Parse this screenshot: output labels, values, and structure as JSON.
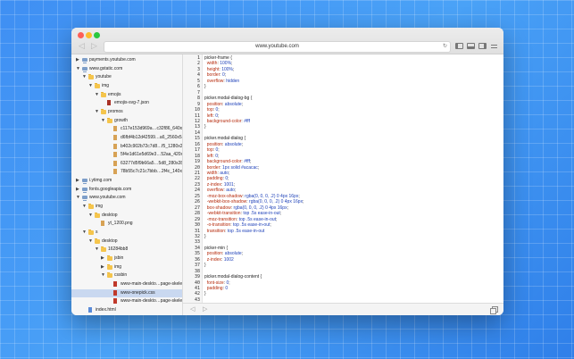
{
  "browser": {
    "url": "www.youtube.com",
    "back_glyph": "◁",
    "forward_glyph": "▷",
    "reload_glyph": "↻"
  },
  "tree": [
    {
      "label": "payments.youtube.com",
      "icon": "site",
      "depth": 0,
      "expanded": false
    },
    {
      "label": "www.gstatic.com",
      "icon": "site",
      "depth": 0,
      "expanded": true
    },
    {
      "label": "youtube",
      "icon": "folder",
      "depth": 1,
      "expanded": true
    },
    {
      "label": "img",
      "icon": "folder",
      "depth": 2,
      "expanded": true
    },
    {
      "label": "emojis",
      "icon": "folder",
      "depth": 3,
      "expanded": true
    },
    {
      "label": "emojis-svg-7.json",
      "icon": "json",
      "depth": 4
    },
    {
      "label": "promos",
      "icon": "folder",
      "depth": 3,
      "expanded": true
    },
    {
      "label": "growth",
      "icon": "folder",
      "depth": 4,
      "expanded": true
    },
    {
      "label": "c117e153d969a…c32f86_640x48.png",
      "icon": "img",
      "depth": 5
    },
    {
      "label": "d6fbf4b12d42599…a6_2560x520.jpeg",
      "icon": "img",
      "depth": 5
    },
    {
      "label": "b402c902b72c7d8…f5_1280x260.jpeg",
      "icon": "img",
      "depth": 5
    },
    {
      "label": "5f4e1d61e5d69e3…52aa_420x420.png",
      "icon": "img",
      "depth": 5
    },
    {
      "label": "63277d5f9b66a5…5d8_280x280.png",
      "icon": "img",
      "depth": 5
    },
    {
      "label": "78b55c7c21c7bbb…2f4c_140x140.png",
      "icon": "img",
      "depth": 5
    },
    {
      "label": "i.ytimg.com",
      "icon": "site",
      "depth": 0,
      "expanded": false
    },
    {
      "label": "fonts.googleapis.com",
      "icon": "site",
      "depth": 0,
      "expanded": false
    },
    {
      "label": "www.youtube.com",
      "icon": "site",
      "depth": 0,
      "expanded": true
    },
    {
      "label": "img",
      "icon": "folder",
      "depth": 1,
      "expanded": true
    },
    {
      "label": "desktop",
      "icon": "folder",
      "depth": 2,
      "expanded": true
    },
    {
      "label": "yt_1200.png",
      "icon": "img",
      "depth": 3
    },
    {
      "label": "s",
      "icon": "folder",
      "depth": 1,
      "expanded": true
    },
    {
      "label": "desktop",
      "icon": "folder",
      "depth": 2,
      "expanded": true
    },
    {
      "label": "16284bb8",
      "icon": "folder",
      "depth": 3,
      "expanded": true
    },
    {
      "label": "jsbin",
      "icon": "folder",
      "depth": 4,
      "expanded": false
    },
    {
      "label": "img",
      "icon": "folder",
      "depth": 4,
      "expanded": false
    },
    {
      "label": "cssbin",
      "icon": "folder",
      "depth": 4,
      "expanded": true
    },
    {
      "label": "www-main-deskto…page-skeleton.css",
      "icon": "css",
      "depth": 5
    },
    {
      "label": "www-onepick.css",
      "icon": "css",
      "depth": 5,
      "selected": true
    },
    {
      "label": "www-main-deskto…page-skeleton.css",
      "icon": "css",
      "depth": 5
    },
    {
      "label": "index.html",
      "icon": "html",
      "depth": 1
    }
  ],
  "code_lines": [
    [
      [
        "sel",
        "picker-frame "
      ],
      [
        "punc",
        "{"
      ]
    ],
    [
      [
        "prop",
        "  width"
      ],
      [
        "punc",
        ": "
      ],
      [
        "val",
        "100%"
      ],
      [
        "punc",
        ";"
      ]
    ],
    [
      [
        "prop",
        "  height"
      ],
      [
        "punc",
        ": "
      ],
      [
        "val",
        "100%"
      ],
      [
        "punc",
        ";"
      ]
    ],
    [
      [
        "prop",
        "  border"
      ],
      [
        "punc",
        ": "
      ],
      [
        "val",
        "0"
      ],
      [
        "punc",
        ";"
      ]
    ],
    [
      [
        "prop",
        "  overflow"
      ],
      [
        "punc",
        ": "
      ],
      [
        "val",
        "hidden"
      ]
    ],
    [
      [
        "punc",
        "}"
      ]
    ],
    [],
    [
      [
        "sel",
        "picker.modal-dialog-bg "
      ],
      [
        "punc",
        "{"
      ]
    ],
    [
      [
        "prop",
        "  position"
      ],
      [
        "punc",
        ": "
      ],
      [
        "val",
        "absolute"
      ],
      [
        "punc",
        ";"
      ]
    ],
    [
      [
        "prop",
        "  top"
      ],
      [
        "punc",
        ": "
      ],
      [
        "val",
        "0"
      ],
      [
        "punc",
        ";"
      ]
    ],
    [
      [
        "prop",
        "  left"
      ],
      [
        "punc",
        ": "
      ],
      [
        "val",
        "0"
      ],
      [
        "punc",
        ";"
      ]
    ],
    [
      [
        "prop",
        "  background-color"
      ],
      [
        "punc",
        ": "
      ],
      [
        "val",
        "#fff"
      ]
    ],
    [
      [
        "punc",
        "}"
      ]
    ],
    [],
    [
      [
        "sel",
        "picker.modal-dialog "
      ],
      [
        "punc",
        "{"
      ]
    ],
    [
      [
        "prop",
        "  position"
      ],
      [
        "punc",
        ": "
      ],
      [
        "val",
        "absolute"
      ],
      [
        "punc",
        ";"
      ]
    ],
    [
      [
        "prop",
        "  top"
      ],
      [
        "punc",
        ": "
      ],
      [
        "val",
        "0"
      ],
      [
        "punc",
        ";"
      ]
    ],
    [
      [
        "prop",
        "  left"
      ],
      [
        "punc",
        ": "
      ],
      [
        "val",
        "0"
      ],
      [
        "punc",
        ";"
      ]
    ],
    [
      [
        "prop",
        "  background-color"
      ],
      [
        "punc",
        ": "
      ],
      [
        "val",
        "#fff"
      ],
      [
        "punc",
        ";"
      ]
    ],
    [
      [
        "prop",
        "  border"
      ],
      [
        "punc",
        ": "
      ],
      [
        "val",
        "1px solid #acacac"
      ],
      [
        "punc",
        ";"
      ]
    ],
    [
      [
        "prop",
        "  width"
      ],
      [
        "punc",
        ": "
      ],
      [
        "val",
        "auto"
      ],
      [
        "punc",
        ";"
      ]
    ],
    [
      [
        "prop",
        "  padding"
      ],
      [
        "punc",
        ": "
      ],
      [
        "val",
        "0"
      ],
      [
        "punc",
        ";"
      ]
    ],
    [
      [
        "prop",
        "  z-index"
      ],
      [
        "punc",
        ": "
      ],
      [
        "val",
        "1001"
      ],
      [
        "punc",
        ";"
      ]
    ],
    [
      [
        "prop",
        "  overflow"
      ],
      [
        "punc",
        ": "
      ],
      [
        "val",
        "auto"
      ],
      [
        "punc",
        ";"
      ]
    ],
    [
      [
        "prop",
        "  -moz-box-shadow"
      ],
      [
        "punc",
        ": "
      ],
      [
        "val",
        "rgba(0, 0, 0, .2) 0 4px 16px"
      ],
      [
        "punc",
        ";"
      ]
    ],
    [
      [
        "prop",
        "  -webkit-box-shadow"
      ],
      [
        "punc",
        ": "
      ],
      [
        "val",
        "rgba(0, 0, 0, .2) 0 4px 16px"
      ],
      [
        "punc",
        ";"
      ]
    ],
    [
      [
        "prop",
        "  box-shadow"
      ],
      [
        "punc",
        ": "
      ],
      [
        "val",
        "rgba(0, 0, 0, .2) 0 4px 16px"
      ],
      [
        "punc",
        ";"
      ]
    ],
    [
      [
        "prop",
        "  -webkit-transition"
      ],
      [
        "punc",
        ": "
      ],
      [
        "val",
        "top .5s ease-in-out"
      ],
      [
        "punc",
        ";"
      ]
    ],
    [
      [
        "prop",
        "  -moz-transition"
      ],
      [
        "punc",
        ": "
      ],
      [
        "val",
        "top .5s ease-in-out"
      ],
      [
        "punc",
        ";"
      ]
    ],
    [
      [
        "prop",
        "  -o-transition"
      ],
      [
        "punc",
        ": "
      ],
      [
        "val",
        "top .5s ease-in-out"
      ],
      [
        "punc",
        ";"
      ]
    ],
    [
      [
        "prop",
        "  transition"
      ],
      [
        "punc",
        ": "
      ],
      [
        "val",
        "top .5s ease-in-out"
      ]
    ],
    [
      [
        "punc",
        "}"
      ]
    ],
    [],
    [
      [
        "sel",
        "picker-min "
      ],
      [
        "punc",
        "{"
      ]
    ],
    [
      [
        "prop",
        "  position"
      ],
      [
        "punc",
        ": "
      ],
      [
        "val",
        "absolute"
      ],
      [
        "punc",
        ";"
      ]
    ],
    [
      [
        "prop",
        "  z-index"
      ],
      [
        "punc",
        ": "
      ],
      [
        "val",
        "1002"
      ]
    ],
    [
      [
        "punc",
        "}"
      ]
    ],
    [],
    [
      [
        "sel",
        "picker.modal-dialog-content "
      ],
      [
        "punc",
        "{"
      ]
    ],
    [
      [
        "prop",
        "  font-size"
      ],
      [
        "punc",
        ": "
      ],
      [
        "val",
        "0"
      ],
      [
        "punc",
        ";"
      ]
    ],
    [
      [
        "prop",
        "  padding"
      ],
      [
        "punc",
        ": "
      ],
      [
        "val",
        "0"
      ]
    ],
    [
      [
        "punc",
        "}"
      ]
    ],
    []
  ],
  "bottombar": {
    "left_glyph": "◁",
    "right_glyph": "▷"
  }
}
